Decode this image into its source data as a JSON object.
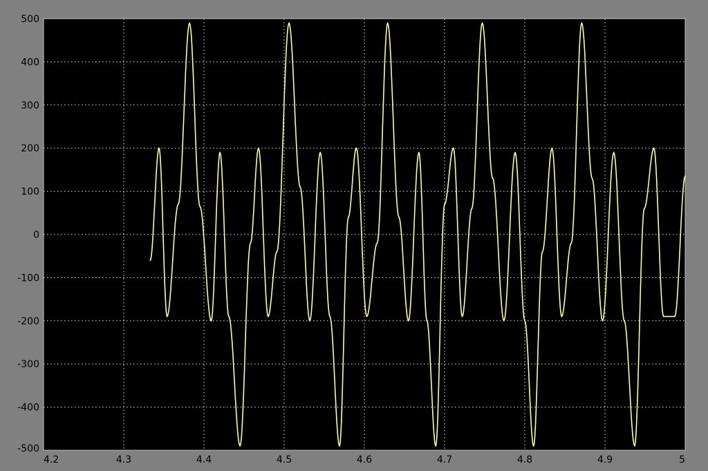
{
  "window": {
    "background": "#808080"
  },
  "chart_data": {
    "type": "line",
    "title": "",
    "xlabel": "",
    "ylabel": "",
    "xlim": [
      4.2,
      5.0
    ],
    "ylim": [
      -500,
      500
    ],
    "xticks": [
      4.2,
      4.3,
      4.4,
      4.5,
      4.6,
      4.7,
      4.8,
      4.9,
      5.0
    ],
    "xtick_labels": [
      "4.2",
      "4.3",
      "4.4",
      "4.5",
      "4.6",
      "4.7",
      "4.8",
      "4.9",
      "5"
    ],
    "yticks": [
      500,
      400,
      300,
      200,
      100,
      0,
      -100,
      -200,
      -300,
      -400,
      -500
    ],
    "ytick_labels": [
      "500",
      "400",
      "300",
      "200",
      "100",
      "0",
      "-100",
      "-200",
      "-300",
      "-400",
      "-500"
    ],
    "grid": true,
    "grid_style": "dotted",
    "plot_background": "#000000",
    "colors": {
      "line": "#ffff99",
      "grid": "#e6e6e6"
    },
    "series": [
      {
        "x": [
          4.333,
          4.344,
          4.354,
          4.368,
          4.382,
          4.395,
          4.409,
          4.42,
          4.431,
          4.445,
          4.458,
          4.468,
          4.48,
          4.491,
          4.506,
          4.52,
          4.532,
          4.545,
          4.557,
          4.569,
          4.58,
          4.59,
          4.603,
          4.616,
          4.629,
          4.643,
          4.655,
          4.668,
          4.678,
          4.689,
          4.7,
          4.711,
          4.722,
          4.734,
          4.747,
          4.76,
          4.774,
          4.788,
          4.8,
          4.811,
          4.822,
          4.834,
          4.846,
          4.858,
          4.871,
          4.884,
          4.897,
          4.911,
          4.924,
          4.937,
          4.949,
          4.961,
          4.973,
          4.987,
          5.0
        ],
        "y": [
          -60,
          200,
          -190,
          70,
          490,
          65,
          -200,
          190,
          -190,
          -490,
          -20,
          200,
          -190,
          -40,
          490,
          110,
          -200,
          190,
          -190,
          -490,
          40,
          200,
          -190,
          -20,
          490,
          40,
          -200,
          190,
          -200,
          -490,
          70,
          200,
          -190,
          60,
          490,
          130,
          -200,
          190,
          -200,
          -490,
          -40,
          200,
          -190,
          -20,
          490,
          130,
          -200,
          190,
          -200,
          -490,
          60,
          200,
          -190,
          -190,
          135
        ]
      }
    ]
  }
}
